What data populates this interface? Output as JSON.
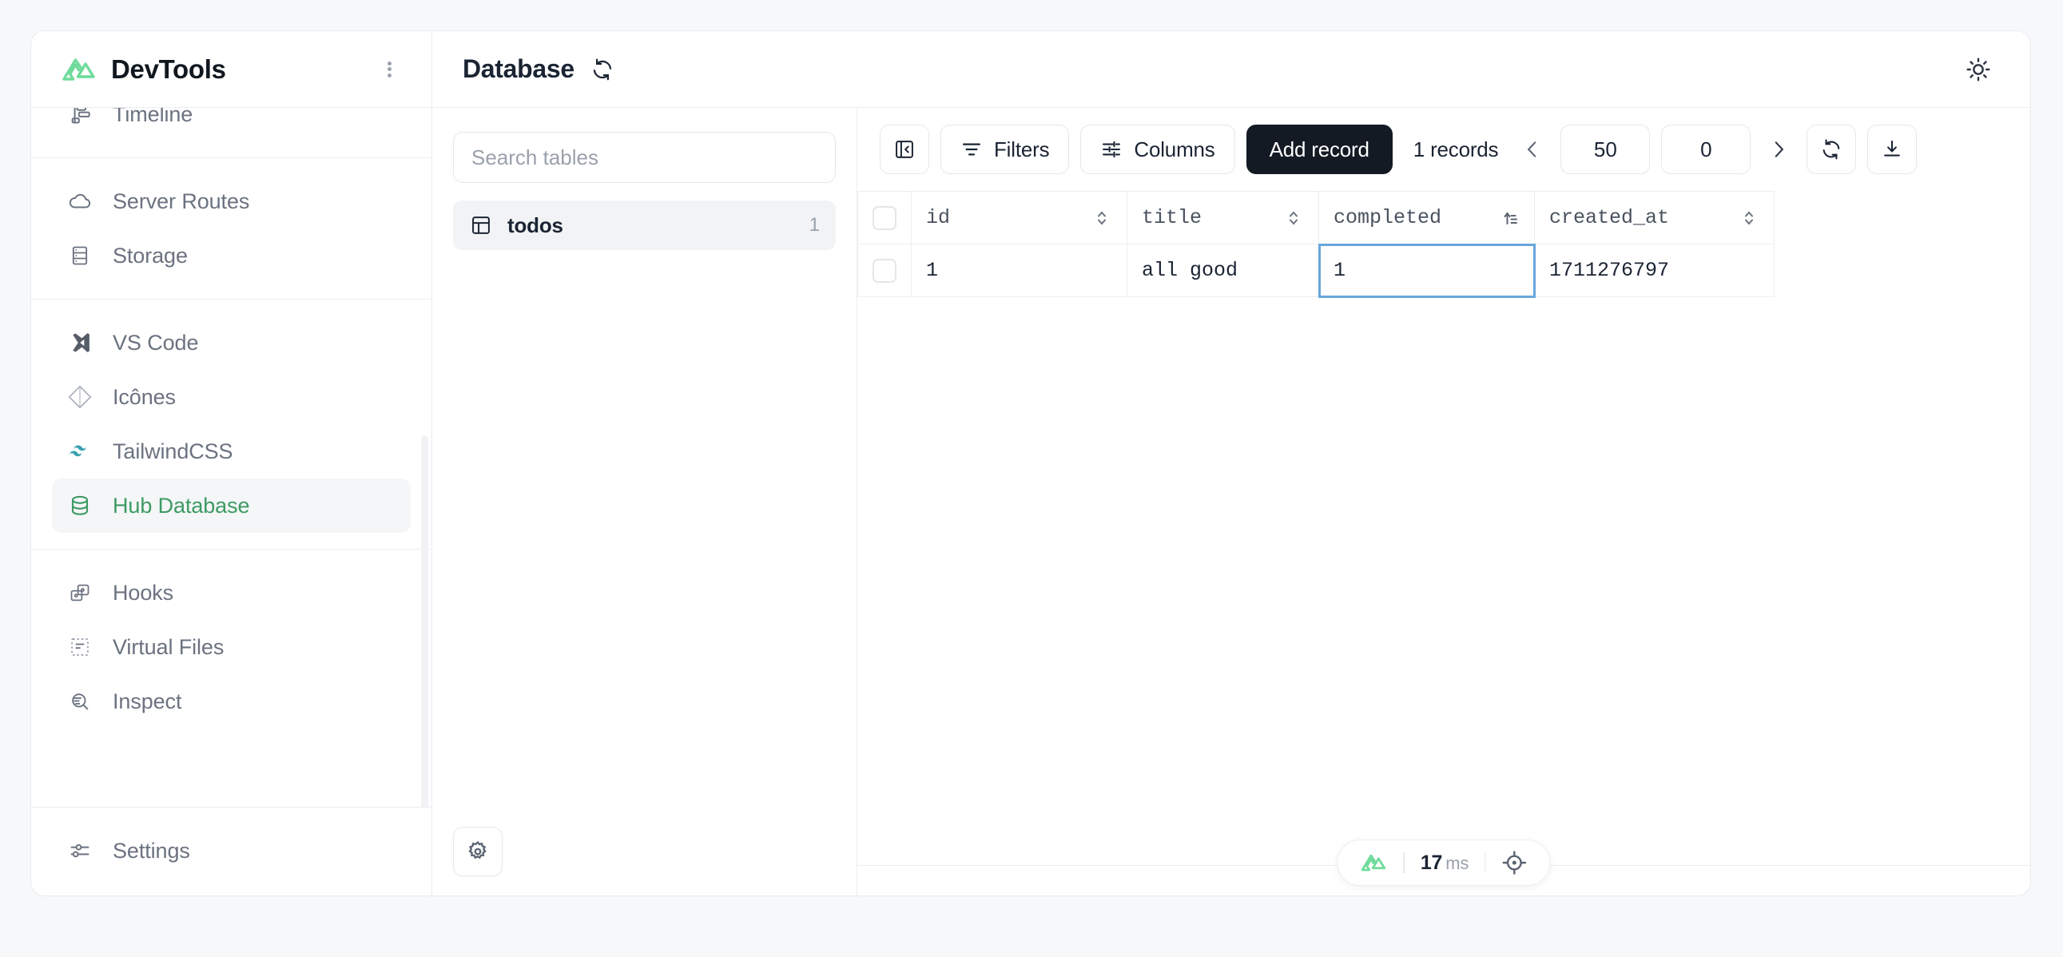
{
  "app": {
    "name": "DevTools",
    "logo_icon": "nuxt-logo",
    "menu_icon": "kebab-menu-icon"
  },
  "sidebar": {
    "groups": [
      {
        "items": [
          {
            "label": "Timeline",
            "icon": "timeline-icon",
            "active": false
          }
        ]
      },
      {
        "items": [
          {
            "label": "Server Routes",
            "icon": "cloud-icon",
            "active": false
          },
          {
            "label": "Storage",
            "icon": "storage-icon",
            "active": false
          }
        ]
      },
      {
        "items": [
          {
            "label": "VS Code",
            "icon": "vscode-icon",
            "active": false
          },
          {
            "label": "Icônes",
            "icon": "icones-diamond-icon",
            "active": false
          },
          {
            "label": "TailwindCSS",
            "icon": "tailwind-icon",
            "active": false
          },
          {
            "label": "Hub Database",
            "icon": "database-icon",
            "active": true
          }
        ]
      },
      {
        "items": [
          {
            "label": "Hooks",
            "icon": "hooks-icon",
            "active": false
          },
          {
            "label": "Virtual Files",
            "icon": "virtual-files-icon",
            "active": false
          },
          {
            "label": "Inspect",
            "icon": "inspect-icon",
            "active": false
          }
        ]
      }
    ],
    "footer": [
      {
        "label": "Settings",
        "icon": "settings-sliders-icon",
        "active": false
      }
    ]
  },
  "header": {
    "title": "Database",
    "refresh_icon": "refresh-icon",
    "theme_icon": "sun-icon"
  },
  "tables_panel": {
    "search_placeholder": "Search tables",
    "search_value": "",
    "tables": [
      {
        "name": "todos",
        "count": "1",
        "icon": "table-icon",
        "active": true
      }
    ],
    "settings_icon": "gear-icon"
  },
  "toolbar": {
    "collapse_label": "",
    "collapse_icon": "panel-collapse-icon",
    "filters_label": "Filters",
    "filters_icon": "filter-icon",
    "columns_label": "Columns",
    "columns_icon": "sliders-icon",
    "add_record_label": "Add record",
    "records_text": "1 records",
    "prev_icon": "chevron-left-icon",
    "next_icon": "chevron-right-icon",
    "limit_value": "50",
    "offset_value": "0",
    "refresh_icon": "refresh-circle-icon",
    "download_icon": "download-icon"
  },
  "table": {
    "columns": [
      {
        "name": "id",
        "sort": "none"
      },
      {
        "name": "title",
        "sort": "none"
      },
      {
        "name": "completed",
        "sort": "asc"
      },
      {
        "name": "created_at",
        "sort": "none"
      }
    ],
    "rows": [
      {
        "checked": false,
        "id": "1",
        "title": "all good",
        "completed": "1",
        "created_at": "1711276797"
      }
    ],
    "active_cell": "completed"
  },
  "status_bar": {
    "logo_icon": "nuxt-logo",
    "duration": "17",
    "duration_unit": "ms",
    "target_icon": "crosshair-icon"
  },
  "colors": {
    "accent_green": "#3d9a64",
    "logo_green": "#6fdb9b",
    "primary_dark": "#141a24",
    "active_cell_border": "#6aa6dd",
    "tailwind_teal": "#38a0ae",
    "text_muted": "#6b7280"
  }
}
